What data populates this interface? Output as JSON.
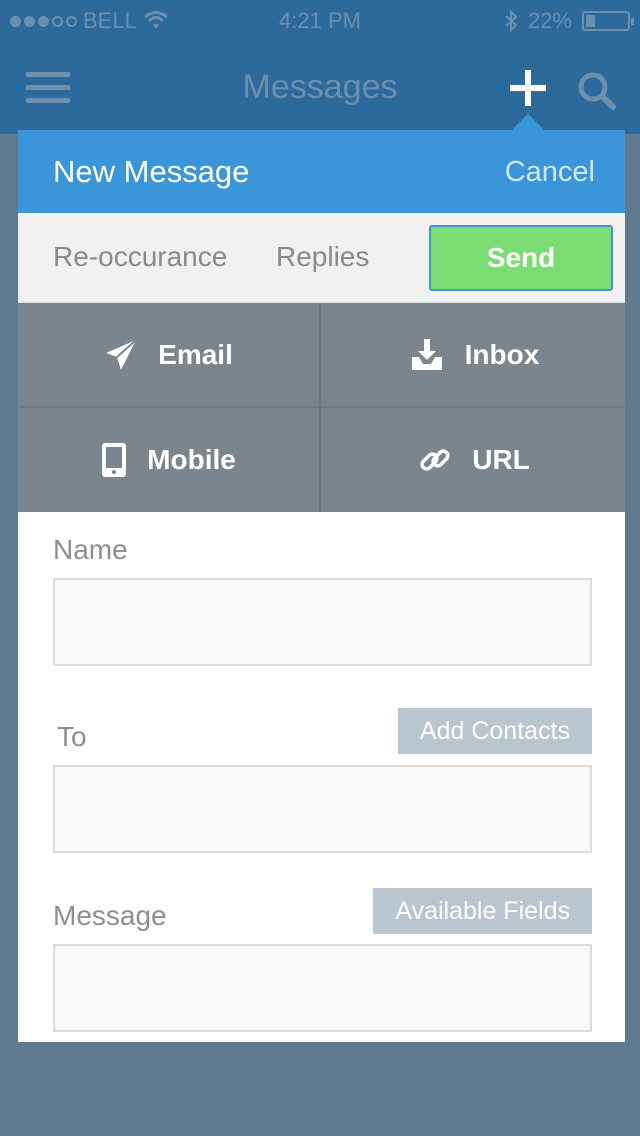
{
  "status_bar": {
    "carrier": "BELL",
    "time": "4:21 PM",
    "battery": "22%",
    "battery_level": 0.22,
    "signal_bars_filled": 3,
    "signal_bars_total": 5
  },
  "navbar": {
    "title": "Messages",
    "icons": [
      "menu-icon",
      "plus-icon",
      "search-icon"
    ]
  },
  "modal": {
    "title": "New Message",
    "cancel_label": "Cancel",
    "options": {
      "reoccurance_label": "Re-occurance",
      "replies_label": "Replies",
      "send_label": "Send"
    },
    "channels": [
      {
        "label": "Email",
        "icon": "paper-plane-icon"
      },
      {
        "label": "Inbox",
        "icon": "inbox-download-icon"
      },
      {
        "label": "Mobile",
        "icon": "mobile-phone-icon"
      },
      {
        "label": "URL",
        "icon": "link-icon"
      }
    ],
    "form": {
      "name_label": "Name",
      "name_value": "",
      "to_label": "To",
      "to_value": "",
      "add_contacts_label": "Add Contacts",
      "message_label": "Message",
      "message_value": "",
      "available_fields_label": "Available Fields"
    }
  },
  "colors": {
    "header_blue": "#3a96d8",
    "send_green": "#7bdc74",
    "tile_gray": "#7b858e",
    "backdrop": "#5f7a8f"
  }
}
